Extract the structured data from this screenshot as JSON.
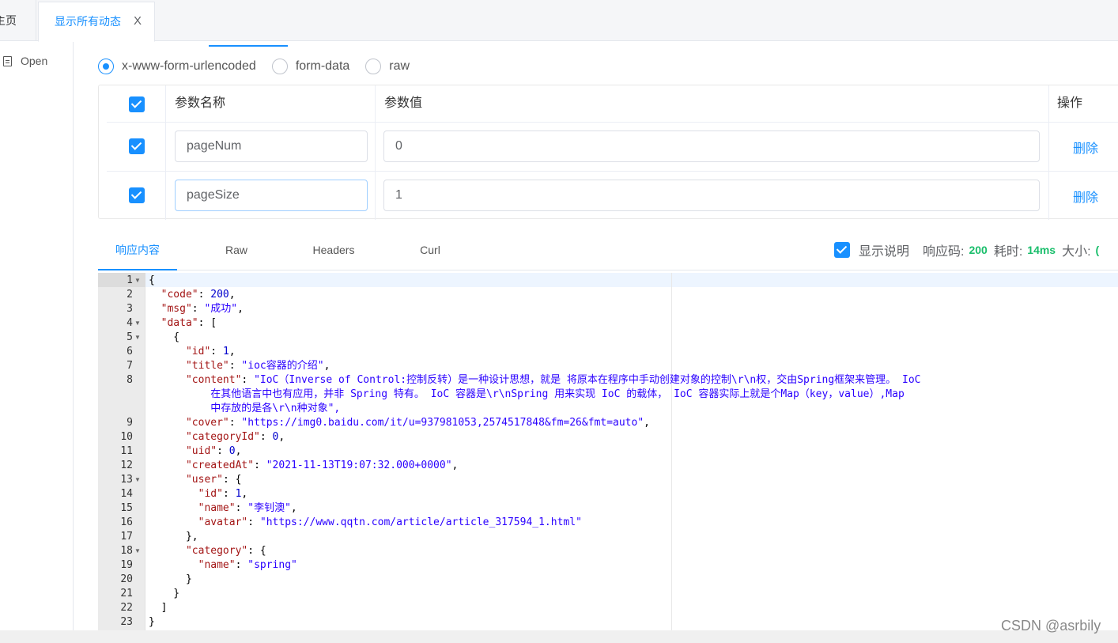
{
  "tabs": {
    "home_label": "主页",
    "active_label": "显示所有动态",
    "close_glyph": "X"
  },
  "sidebar": {
    "open_label": "Open"
  },
  "body_types": [
    {
      "label": "x-www-form-urlencoded",
      "checked": true
    },
    {
      "label": "form-data",
      "checked": false
    },
    {
      "label": "raw",
      "checked": false
    }
  ],
  "params": {
    "headers": {
      "name": "参数名称",
      "value": "参数值",
      "action": "操作"
    },
    "rows": [
      {
        "name": "pageNum",
        "value": "0",
        "action": "删除"
      },
      {
        "name": "pageSize",
        "value": "1",
        "action": "删除"
      }
    ]
  },
  "response_tabs": [
    "响应内容",
    "Raw",
    "Headers",
    "Curl"
  ],
  "meta": {
    "show_desc": "显示说明",
    "code_label": "响应码:",
    "code_value": "200",
    "time_label": "耗时:",
    "time_value": "14ms",
    "size_label": "大小:",
    "size_value": "("
  },
  "code": {
    "line_numbers": [
      "1",
      "2",
      "3",
      "4",
      "5",
      "6",
      "7",
      "8",
      "9",
      "10",
      "11",
      "12",
      "13",
      "14",
      "15",
      "16",
      "17",
      "18",
      "19",
      "20",
      "21",
      "22",
      "23"
    ],
    "lines": [
      "{",
      "  \"code\": 200,",
      "  \"msg\": \"成功\",",
      "  \"data\": [",
      "    {",
      "      \"id\": 1,",
      "      \"title\": \"ioc容器的介绍\",",
      "      \"content\": \"IoC（Inverse of Control:控制反转）是一种设计思想，就是 将原本在程序中手动创建对象的控制\\r\\n权，交由Spring框架来管理。 IoC",
      "          在其他语言中也有应用，并非 Spring 特有。 IoC 容器是\\r\\nSpring 用来实现 IoC 的载体， IoC 容器实际上就是个Map（key，value）,Map",
      "          中存放的是各\\r\\n种对象\",",
      "      \"cover\": \"https://img0.baidu.com/it/u=937981053,2574517848&fm=26&fmt=auto\",",
      "      \"categoryId\": 0,",
      "      \"uid\": 0,",
      "      \"createdAt\": \"2021-11-13T19:07:32.000+0000\",",
      "      \"user\": {",
      "        \"id\": 1,",
      "        \"name\": \"李钊澳\",",
      "        \"avatar\": \"https://www.qqtn.com/article/article_317594_1.html\"",
      "      },",
      "      \"category\": {",
      "        \"name\": \"spring\"",
      "      }",
      "    }",
      "  ]",
      "}"
    ]
  },
  "watermark": "CSDN @asrbily"
}
